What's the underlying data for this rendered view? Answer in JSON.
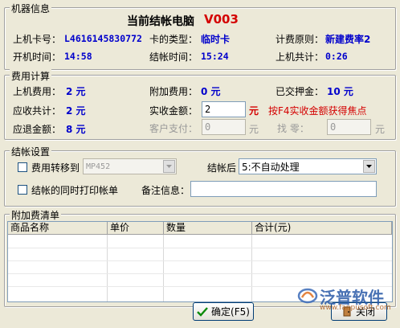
{
  "machine_info": {
    "group_title": "机器信息",
    "header_label": "当前结帐电脑",
    "header_value": "V003",
    "card_label": "上机卡号：",
    "card_value": "L4616145830772",
    "card_type_label": "卡的类型：",
    "card_type_value": "临时卡",
    "billing_rule_label": "计费原则：",
    "billing_rule_value": "新建费率2",
    "start_label": "开机时间：",
    "start_value": "14:58",
    "checkout_label": "结帐时间：",
    "checkout_value": "15:24",
    "total_label": "上机共计：",
    "total_value": "0:26"
  },
  "fee_calc": {
    "group_title": "费用计算",
    "usage_label": "上机费用：",
    "usage_value": "2 元",
    "extra_label": "附加费用：",
    "extra_value": "0 元",
    "deposit_label": "已交押金：",
    "deposit_value": "10 元",
    "receivable_label": "应收共计：",
    "receivable_value": "2 元",
    "received_label": "实收金额：",
    "received_input": "2",
    "received_unit": "元",
    "hint": "按F4实收金额获得焦点",
    "refund_label": "应退金额：",
    "refund_value": "8 元",
    "customer_pay_label": "客户支付：",
    "customer_pay_input": "0",
    "customer_pay_unit": "元",
    "change_label": "找  零：",
    "change_input": "0",
    "change_unit": "元"
  },
  "checkout_settings": {
    "group_title": "结帐设置",
    "transfer_label": "费用转移到",
    "transfer_select": "MP452",
    "after_label": "结帐后",
    "after_select": "5:不自动处理",
    "print_label": "结帐的同时打印帐单",
    "remark_label": "备注信息：",
    "remark_value": ""
  },
  "extra_fees": {
    "group_title": "附加费清单",
    "columns": [
      "商品名称",
      "单价",
      "数量",
      "合计(元)"
    ]
  },
  "buttons": {
    "confirm": "确定(F5)",
    "close": "关闭"
  },
  "watermark": {
    "brand": "泛普软件",
    "url": "www.fanpusoft.com"
  }
}
